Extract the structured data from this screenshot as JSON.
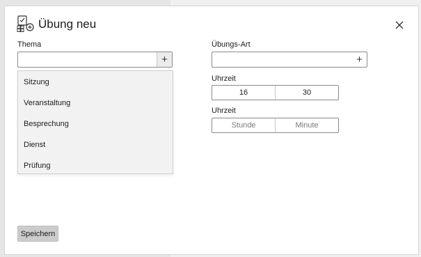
{
  "dialog": {
    "title": "Übung neu",
    "icon": "calendar-clipboard-add-icon",
    "close_icon": "close-icon"
  },
  "left": {
    "thema_label": "Thema",
    "thema_value": "",
    "thema_add": "+",
    "dropdown_items": [
      "Sitzung",
      "Veranstaltung",
      "Besprechung",
      "Dienst",
      "Prüfung"
    ]
  },
  "right": {
    "art_label": "Übungs-Art",
    "art_value": "",
    "art_add": "+",
    "time1_label": "Uhrzeit",
    "time1_hour": "16",
    "time1_minute": "30",
    "time2_label": "Uhrzeit",
    "time2_hour_placeholder": "Stunde",
    "time2_minute_placeholder": "Minute"
  },
  "footer": {
    "save_label": "Speichern"
  }
}
